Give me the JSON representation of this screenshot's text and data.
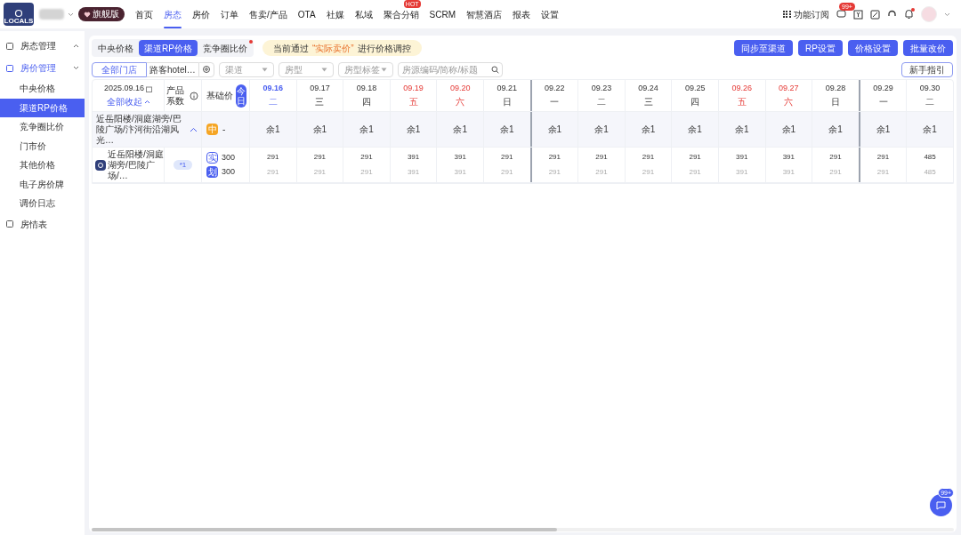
{
  "brand": {
    "logo_text": "LOCALS",
    "plan_badge": "旗舰版"
  },
  "nav": [
    {
      "label": "首页",
      "selected": false
    },
    {
      "label": "房态",
      "selected": true
    },
    {
      "label": "房价",
      "selected": false
    },
    {
      "label": "订单",
      "selected": false
    },
    {
      "label": "售卖/产品",
      "selected": false
    },
    {
      "label": "OTA",
      "selected": false
    },
    {
      "label": "社媒",
      "selected": false
    },
    {
      "label": "私域",
      "selected": false
    },
    {
      "label": "聚合分销",
      "selected": false,
      "badge": "HOT"
    },
    {
      "label": "SCRM",
      "selected": false
    },
    {
      "label": "智慧酒店",
      "selected": false
    },
    {
      "label": "报表",
      "selected": false
    },
    {
      "label": "设置",
      "selected": false
    }
  ],
  "top_right": {
    "subscribe": "功能订阅",
    "message_badge": "99+"
  },
  "sidebar": {
    "items": [
      {
        "label": "房态管理",
        "expanded": false,
        "selected": false
      },
      {
        "label": "房价管理",
        "expanded": true,
        "selected": true,
        "children": [
          {
            "label": "中央价格",
            "selected": false
          },
          {
            "label": "渠道RP价格",
            "selected": true
          },
          {
            "label": "竞争圈比价",
            "selected": false
          },
          {
            "label": "门市价",
            "selected": false
          },
          {
            "label": "其他价格",
            "selected": false
          },
          {
            "label": "电子房价牌",
            "selected": false
          },
          {
            "label": "调价日志",
            "selected": false
          }
        ]
      },
      {
        "label": "房情表",
        "selected": false
      }
    ]
  },
  "tabs": [
    {
      "label": "中央价格",
      "selected": false,
      "dot": false
    },
    {
      "label": "渠道RP价格",
      "selected": true,
      "dot": false
    },
    {
      "label": "竞争圈比价",
      "selected": false,
      "dot": true
    }
  ],
  "notice": {
    "before": "当前通过",
    "highlight": "“实际卖价”",
    "after": "进行价格调控"
  },
  "actions": [
    "同步至渠道",
    "RP设置",
    "价格设置",
    "批量改价"
  ],
  "guide_button": "新手指引",
  "filters": {
    "store_all": "全部门店",
    "store": "路客hotel…",
    "channel": "渠道",
    "room_type": "房型",
    "room_tag": "房型标签",
    "search_placeholder": "房源编码/简称/标题"
  },
  "table": {
    "date": "2025.09.16",
    "collapse": "全部收起",
    "coef_header": "产品系数",
    "base_header": "基础价",
    "today": "今日",
    "days": [
      {
        "date": "09.16",
        "weekday": "二",
        "weekend": false,
        "today": true,
        "week_start": false
      },
      {
        "date": "09.17",
        "weekday": "三",
        "weekend": false,
        "today": false,
        "week_start": false
      },
      {
        "date": "09.18",
        "weekday": "四",
        "weekend": false,
        "today": false,
        "week_start": false
      },
      {
        "date": "09.19",
        "weekday": "五",
        "weekend": true,
        "today": false,
        "week_start": false
      },
      {
        "date": "09.20",
        "weekday": "六",
        "weekend": true,
        "today": false,
        "week_start": false
      },
      {
        "date": "09.21",
        "weekday": "日",
        "weekend": false,
        "today": false,
        "week_start": false
      },
      {
        "date": "09.22",
        "weekday": "一",
        "weekend": false,
        "today": false,
        "week_start": true
      },
      {
        "date": "09.23",
        "weekday": "二",
        "weekend": false,
        "today": false,
        "week_start": false
      },
      {
        "date": "09.24",
        "weekday": "三",
        "weekend": false,
        "today": false,
        "week_start": false
      },
      {
        "date": "09.25",
        "weekday": "四",
        "weekend": false,
        "today": false,
        "week_start": false
      },
      {
        "date": "09.26",
        "weekday": "五",
        "weekend": true,
        "today": false,
        "week_start": false
      },
      {
        "date": "09.27",
        "weekday": "六",
        "weekend": true,
        "today": false,
        "week_start": false
      },
      {
        "date": "09.28",
        "weekday": "日",
        "weekend": false,
        "today": false,
        "week_start": false
      },
      {
        "date": "09.29",
        "weekday": "一",
        "weekend": false,
        "today": false,
        "week_start": true
      },
      {
        "date": "09.30",
        "weekday": "二",
        "weekend": false,
        "today": false,
        "week_start": false
      }
    ],
    "group": {
      "name": "近岳阳楼/洞庭湖旁/巴陵广场/汴河街沿湖风光…",
      "expanded": true,
      "base_tag": "中",
      "base_value": "-",
      "stock": [
        "余1",
        "余1",
        "余1",
        "余1",
        "余1",
        "余1",
        "余1",
        "余1",
        "余1",
        "余1",
        "余1",
        "余1",
        "余1",
        "余1",
        "余1"
      ]
    },
    "products": [
      {
        "name": "近岳阳楼/洞庭湖旁/巴陵广场/…",
        "coef": "*1",
        "prices": [
          {
            "tag": "实",
            "value": "300",
            "kind": "outline"
          },
          {
            "tag": "划",
            "value": "300",
            "kind": "solid"
          }
        ],
        "actual": [
          "291",
          "291",
          "291",
          "391",
          "391",
          "291",
          "291",
          "291",
          "291",
          "291",
          "391",
          "391",
          "291",
          "291",
          "485"
        ],
        "strike": [
          "291",
          "291",
          "291",
          "391",
          "391",
          "291",
          "291",
          "291",
          "291",
          "291",
          "391",
          "391",
          "291",
          "291",
          "485"
        ]
      }
    ]
  },
  "chat_badge": "99+"
}
